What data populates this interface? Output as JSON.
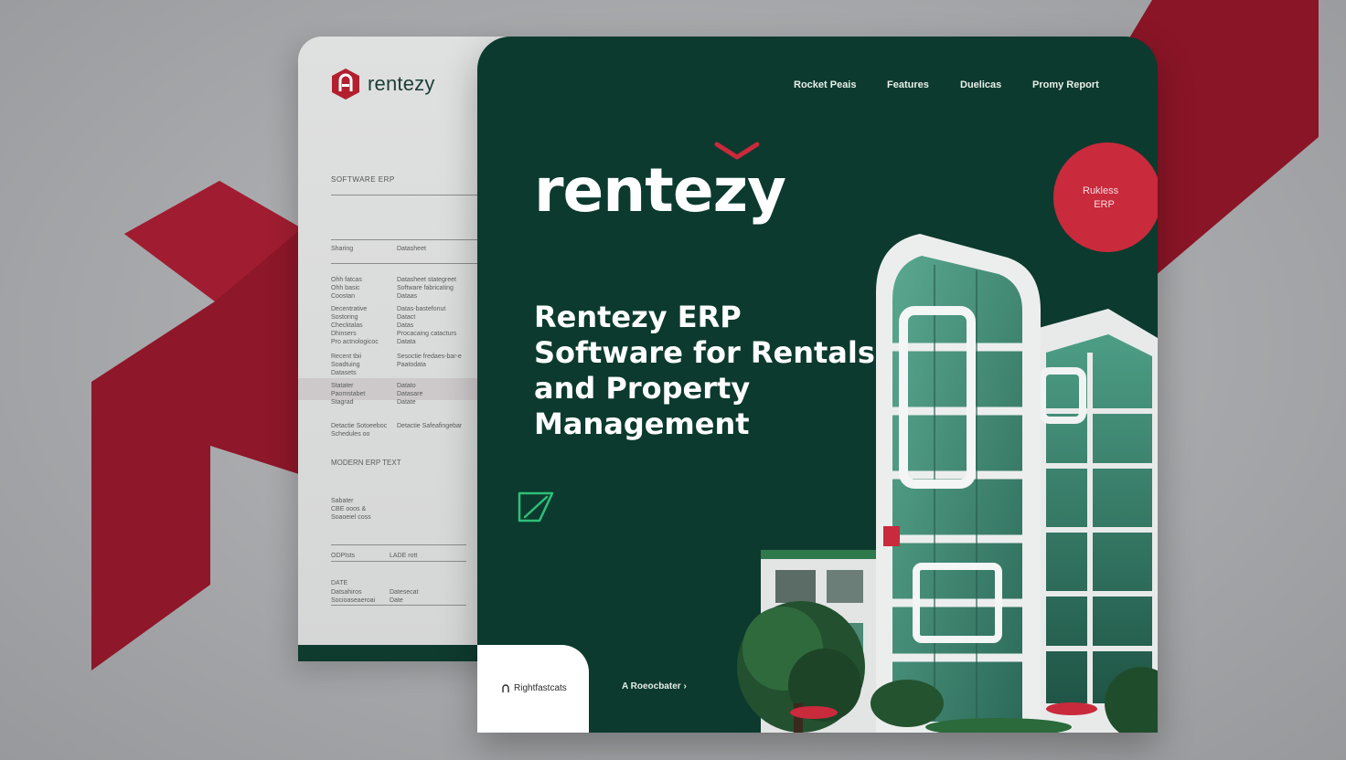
{
  "colors": {
    "brand_red": "#c92a3c",
    "brand_green": "#0c3a2e",
    "building_glass": "#3f8a77",
    "background": "#a7a8ab"
  },
  "document_panel": {
    "logo_text": "rentezy",
    "logo_icon": "rentezy-hex-icon",
    "heading": "SOFTWARE ERP",
    "rows": [
      {
        "left": "Sharing",
        "right": "Datasheet"
      },
      {
        "left": "Ohh fatcas\nOhh basic\nCoostan",
        "right": "Datasheet stategreet\nSoftware fabricating\nDataas"
      },
      {
        "left": "Decentrative\nSostoring\nChecktalas\nDhinsers\nPro actnologicoc",
        "right": "Datas-bastefonut\nDatact\nDatas\nProcacaing catacturs\nDatata"
      },
      {
        "left": "Recent tbii\nSoadtuing\nDatasets",
        "right": "Sesoctie fredaes-bar-e\nPaatodata"
      },
      {
        "left": "Statater\nPaomstabet\nStagrad",
        "right": "Datato\nDatasare\nDatate"
      },
      {
        "left": "Detactie Sotoeeboc\nSchedules oo",
        "right": "Detactie Safeafingebar"
      }
    ],
    "section_title": "MODERN ERP TEXT",
    "section_rows": [
      {
        "left": "Sabater\nCBE ooos &\nSoaoeiel coss",
        "right": ""
      },
      {
        "left": "ODPIsts",
        "right": "LADE rott"
      },
      {
        "left": "DATE",
        "right": ""
      },
      {
        "left": "Datsahiros\nSocioaseaeroai",
        "right": "Datesecat\nDate"
      }
    ]
  },
  "nav": {
    "items": [
      "Rocket Peais",
      "Features",
      "Duelicas",
      "Promy Report"
    ]
  },
  "hero": {
    "brand": "rentezy",
    "headline": "Rentezy ERP Software for Rentals and Property Management",
    "badge": "Rukless\n    ERP",
    "cta_card_label": "Rightfastcats",
    "cta_card_icon": "rentezy-mini-icon",
    "cta_link": "Roeocbater",
    "cta_link_prefix": "A",
    "cta_link_arrow": "›",
    "decor_icon": "leaf-outline-icon"
  }
}
